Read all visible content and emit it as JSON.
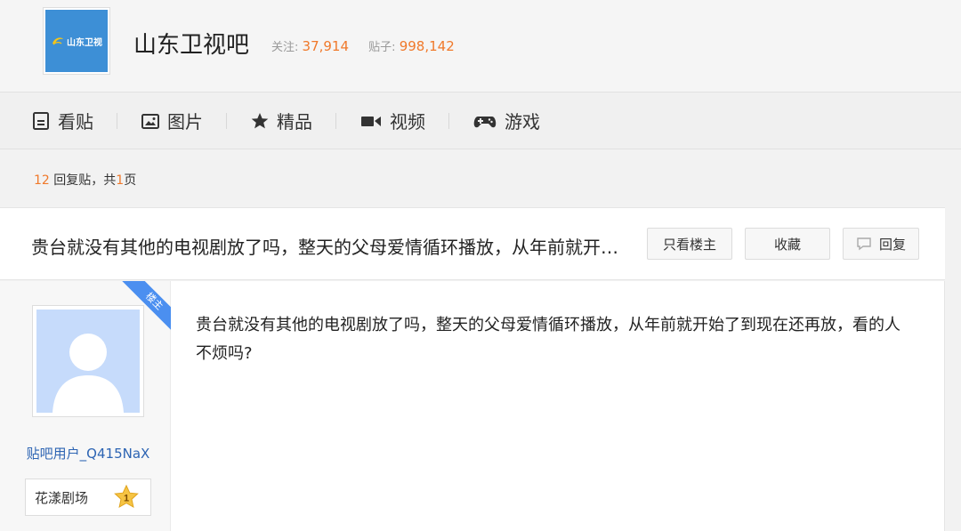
{
  "forum": {
    "logo_text": "山东卫视",
    "name": "山东卫视吧",
    "followers_label": "关注:",
    "followers": "37,914",
    "posts_label": "贴子:",
    "posts": "998,142"
  },
  "nav": [
    {
      "label": "看贴",
      "icon": "document-icon"
    },
    {
      "label": "图片",
      "icon": "image-icon"
    },
    {
      "label": "精品",
      "icon": "star-icon"
    },
    {
      "label": "视频",
      "icon": "video-icon"
    },
    {
      "label": "游戏",
      "icon": "gamepad-icon"
    }
  ],
  "thread_info": {
    "reply_count": "12",
    "reply_text": "回复贴，共",
    "page_count": "1",
    "page_text": "页"
  },
  "thread": {
    "title": "贵台就没有其他的电视剧放了吗，整天的父母爱情循环播放，从年前就开始了到现在还再放，看的人不烦吗?",
    "btn_only_op": "只看楼主",
    "btn_favorite": "收藏",
    "btn_reply": "回复"
  },
  "post": {
    "op_badge": "楼主",
    "username": "贴吧用户_Q415NaX",
    "level_name": "花漾剧场",
    "level": "1",
    "content": "贵台就没有其他的电视剧放了吗，整天的父母爱情循环播放，从年前就开始了到现在还再放，看的人不烦吗?"
  },
  "colors": {
    "accent_orange": "#f0792b",
    "link_blue": "#2d64b3",
    "logo_blue": "#3d8fd6",
    "badge_blue": "#4b8ff0"
  }
}
